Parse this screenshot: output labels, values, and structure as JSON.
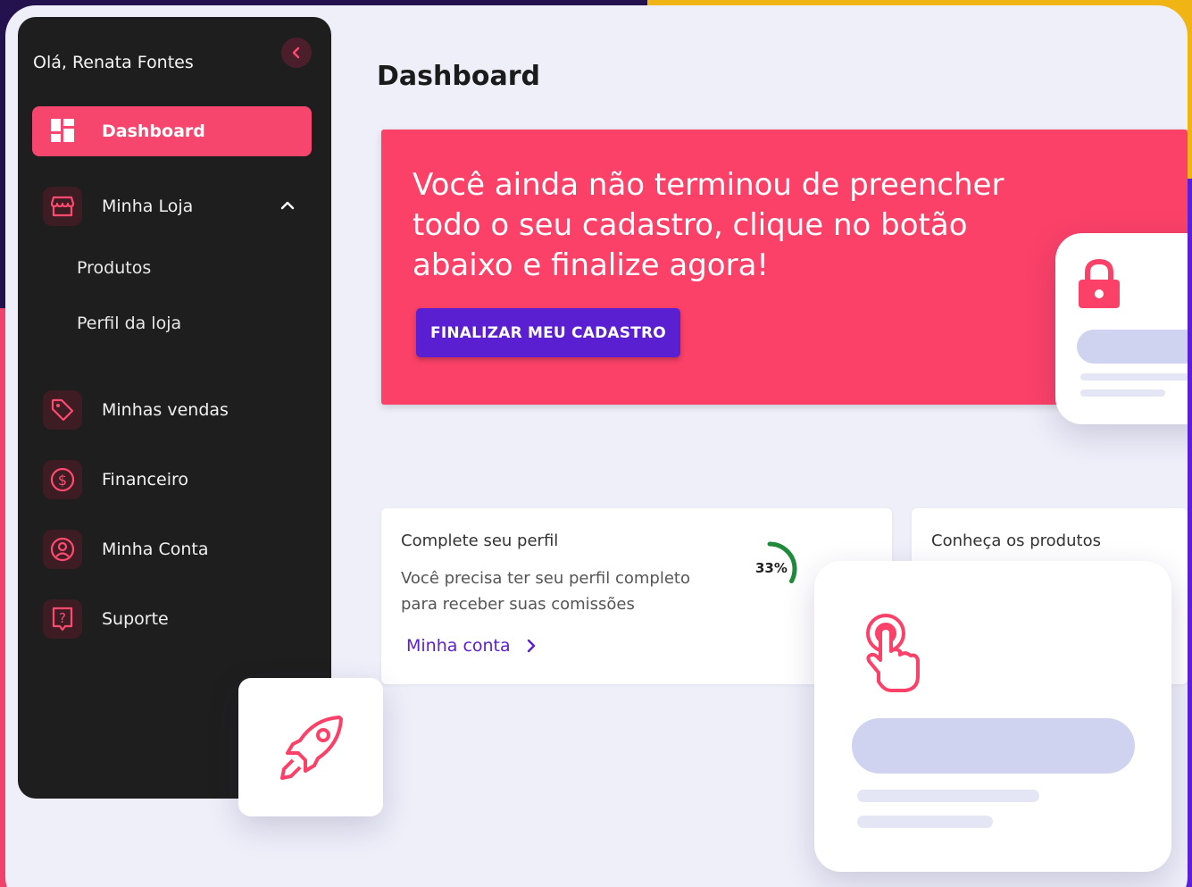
{
  "user": {
    "greeting": "Olá, Renata Fontes"
  },
  "page": {
    "title": "Dashboard"
  },
  "sidebar": {
    "active": {
      "label": "Dashboard",
      "icon": "dashboard-icon"
    },
    "store": {
      "label": "Minha Loja",
      "icon": "store-icon"
    },
    "store_sub": [
      "Produtos",
      "Perfil da loja"
    ],
    "sales": {
      "label": "Minhas vendas",
      "icon": "tag-icon"
    },
    "finance": {
      "label": "Financeiro",
      "icon": "dollar-icon"
    },
    "account": {
      "label": "Minha Conta",
      "icon": "user-icon"
    },
    "support": {
      "label": "Suporte",
      "icon": "help-icon"
    }
  },
  "banner": {
    "message": "Você ainda não terminou de preencher todo o seu cadastro, clique no botão abaixo e finalize agora!",
    "button": "FINALIZAR MEU CADASTRO"
  },
  "profile_card": {
    "title": "Complete seu perfil",
    "description": "Você precisa ter seu perfil completo para receber suas comissões",
    "progress_label": "33%",
    "progress": 0.33,
    "link": "Minha conta"
  },
  "products_card": {
    "title": "Conheça os produtos"
  },
  "colors": {
    "accent": "#fb4168",
    "primary": "#5a1fd1",
    "sidebar": "#1e1e1e"
  }
}
